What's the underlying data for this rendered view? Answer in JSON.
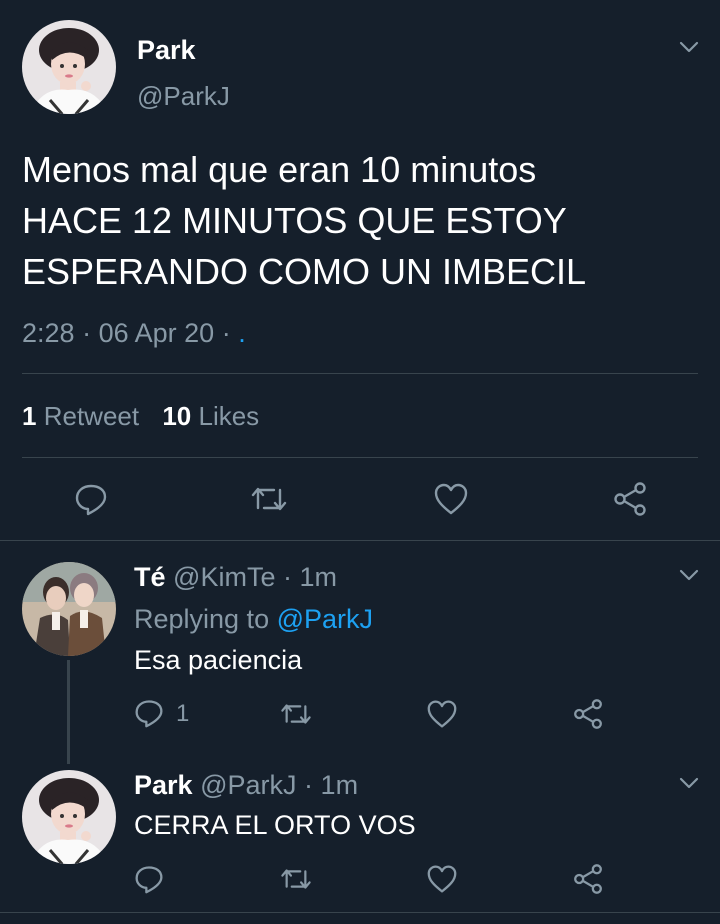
{
  "main_tweet": {
    "display_name": "Park",
    "handle": "@ParkJ",
    "text_lines": [
      "Menos mal que eran 10 minutos",
      "HACE 12 MINUTOS QUE ESTOY",
      "ESPERANDO COMO UN IMBECIL"
    ],
    "time": "2:28",
    "date": "06 Apr 20",
    "source": ".",
    "stats": {
      "retweets_count": "1",
      "retweets_label": "Retweet",
      "likes_count": "10",
      "likes_label": "Likes"
    }
  },
  "replies": [
    {
      "display_name": "Té",
      "handle": "@KimTe",
      "time": "1m",
      "replying_prefix": "Replying to",
      "replying_to": "@ParkJ",
      "text": "Esa paciencia",
      "reply_count": "1"
    },
    {
      "display_name": "Park",
      "handle": "@ParkJ",
      "time": "1m",
      "text": "CERRA EL ORTO VOS"
    }
  ],
  "separator": "·",
  "icons": [
    "chevron-down-icon",
    "reply-icon",
    "retweet-icon",
    "like-icon",
    "share-icon"
  ],
  "colors": {
    "background": "#151f2b",
    "text": "#ffffff",
    "muted": "#8899a6",
    "accent": "#1da1f2",
    "divider": "#38444d"
  }
}
